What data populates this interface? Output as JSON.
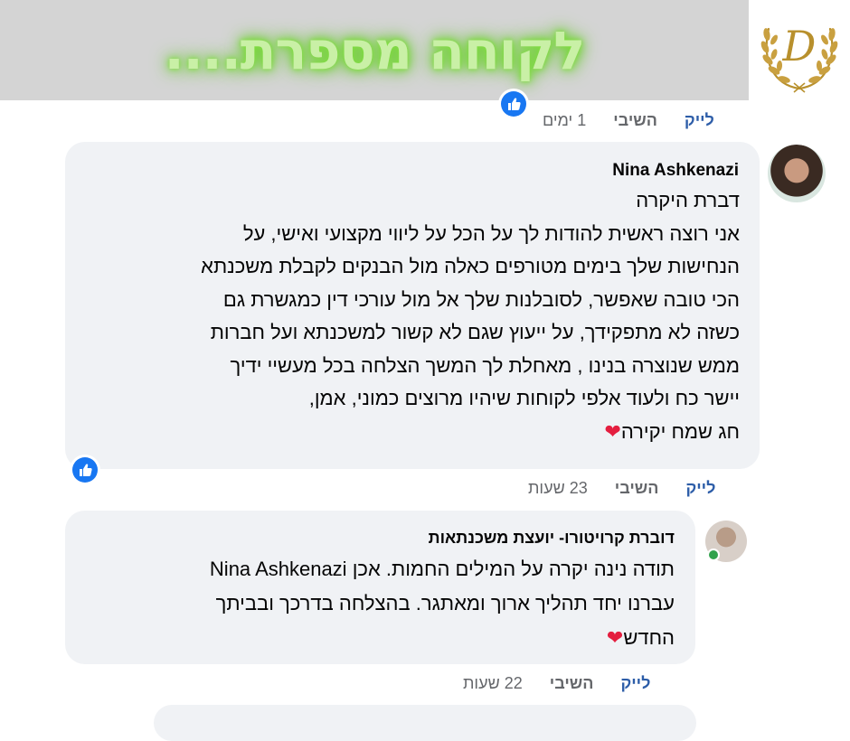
{
  "banner": {
    "title": "לקוחה מספרת...."
  },
  "logo": {
    "letter": "D",
    "accent_color": "#b8902d"
  },
  "top_actions": {
    "like": "לייק",
    "reply": "השיבי",
    "time": "1 ימים"
  },
  "comment1": {
    "author": "Nina Ashkenazi",
    "lines": [
      "דברת היקרה",
      "אני רוצה ראשית להודות לך על הכל על ליווי מקצועי ואישי, על",
      "הנחישות שלך בימים מטורפים כאלה מול הבנקים לקבלת משכנתא",
      "הכי טובה שאפשר, לסובלנות שלך אל מול עורכי דין כמגשרת גם",
      "כשזה לא מתפקידך, על ייעוץ שגם לא קשור למשכנתא ועל חברות",
      "ממש שנוצרה בנינו , מאחלת לך המשך הצלחה בכל מעשיי ידיך",
      "יישר כח ולעוד אלפי לקוחות שיהיו מרוצים כמוני, אמן,",
      "חג שמח יקירה"
    ],
    "heart": "❤",
    "actions": {
      "like": "לייק",
      "reply": "השיבי",
      "time": "23 שעות"
    }
  },
  "comment2": {
    "author": "דוברת קרויטורו- יועצת משכנתאות",
    "lines": [
      "תודה נינה יקרה על המילים החמות. אכן Nina Ashkenazi",
      "עברנו יחד תהליך ארוך ומאתגר. בהצלחה בדרכך ובביתך",
      "החדש"
    ],
    "heart": "❤",
    "actions": {
      "like": "לייק",
      "reply": "השיבי",
      "time": "22 שעות"
    }
  },
  "colors": {
    "bubble": "#f0f2f5",
    "link": "#2d5da8",
    "muted": "#65676b",
    "like_blue": "#1877f2",
    "heart_red": "#e41e3f"
  }
}
